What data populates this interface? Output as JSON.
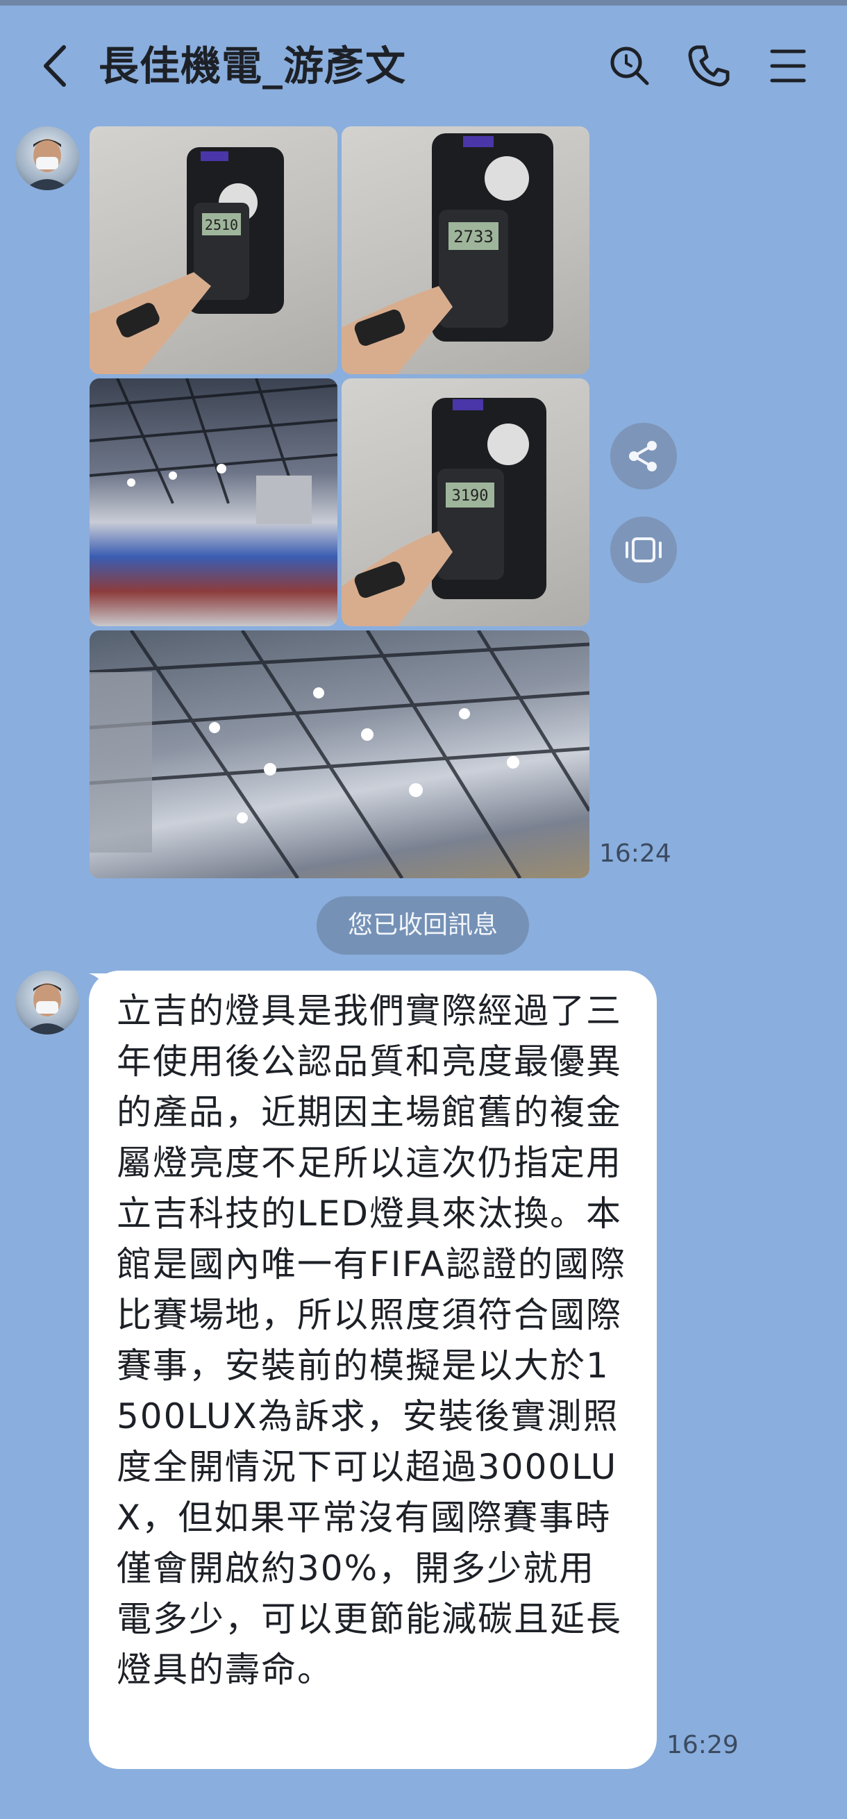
{
  "header": {
    "title": "長佳機電_游彥文",
    "icons": [
      "back-icon",
      "search-icon",
      "phone-icon",
      "menu-icon"
    ]
  },
  "messages": {
    "album_time": "16:24",
    "recalled_notice": "您已收回訊息",
    "text_message": "立吉的燈具是我們實際經過了三年使用後公認品質和亮度最優異的產品，近期因主場館舊的複金屬燈亮度不足所以這次仍指定用立吉科技的LED燈具來汰換。本館是國內唯一有FIFA認證的國際比賽場地，所以照度須符合國際賽事，安裝前的模擬是以大於1500LUX為訴求，安裝後實測照度全開情況下可以超過3000LUX，但如果平常沒有國際賽事時僅會開啟約30%，開多少就用電多少，可以更節能減碳且延長燈具的壽命。",
    "text_time": "16:29"
  },
  "photos": {
    "meter_readings": [
      "2510",
      "2733",
      "3190"
    ]
  },
  "side_actions": [
    "share-icon",
    "slideshow-icon"
  ],
  "colors": {
    "background": "#8aaedd",
    "bubble": "#ffffff",
    "recalled_pill": "#7591b6",
    "side_button": "#7d95b8"
  }
}
